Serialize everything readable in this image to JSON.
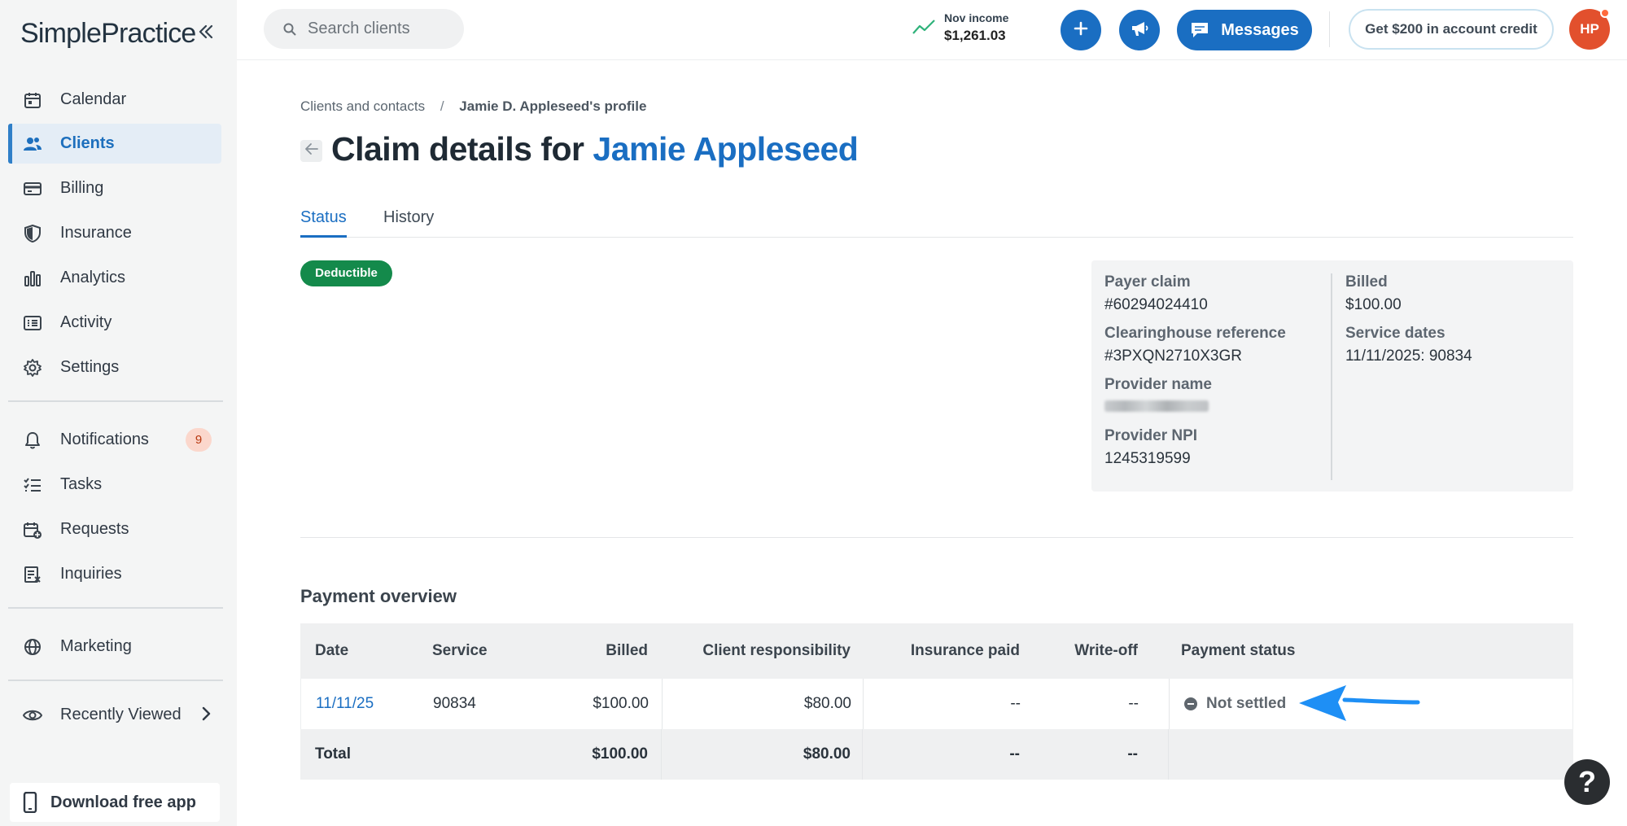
{
  "app": {
    "logo_text": "SimplePractice",
    "collapse_icon": "double-chevron-left-icon"
  },
  "sidebar": {
    "items": [
      {
        "label": "Calendar",
        "icon": "calendar-icon"
      },
      {
        "label": "Clients",
        "icon": "users-icon",
        "active": true
      },
      {
        "label": "Billing",
        "icon": "credit-card-icon"
      },
      {
        "label": "Insurance",
        "icon": "shield-icon"
      },
      {
        "label": "Analytics",
        "icon": "bar-chart-icon"
      },
      {
        "label": "Activity",
        "icon": "list-icon"
      },
      {
        "label": "Settings",
        "icon": "gear-icon"
      }
    ],
    "secondary": [
      {
        "label": "Notifications",
        "icon": "bell-icon",
        "badge": "9"
      },
      {
        "label": "Tasks",
        "icon": "checklist-icon"
      },
      {
        "label": "Requests",
        "icon": "calendar-plus-icon"
      },
      {
        "label": "Inquiries",
        "icon": "inbox-form-icon"
      }
    ],
    "marketing": {
      "label": "Marketing",
      "icon": "globe-icon"
    },
    "recently_viewed": {
      "label": "Recently Viewed",
      "icon": "eye-icon"
    },
    "download": {
      "label": "Download free app",
      "icon": "phone-icon"
    }
  },
  "topbar": {
    "search_placeholder": "Search clients",
    "income_label": "Nov income",
    "income_value": "$1,261.03",
    "messages_label": "Messages",
    "credit_label": "Get $200 in account credit",
    "avatar_initials": "HP"
  },
  "breadcrumb": {
    "parent": "Clients and contacts",
    "separator": "/",
    "current": "Jamie D. Appleseed's profile"
  },
  "page": {
    "title_prefix": "Claim details for",
    "title_name": "Jamie Appleseed",
    "tabs": [
      {
        "label": "Status",
        "active": true
      },
      {
        "label": "History",
        "active": false
      }
    ],
    "status_badge": "Deductible"
  },
  "claim_info": {
    "payer_claim_label": "Payer claim",
    "payer_claim_value": "#60294024410",
    "clearinghouse_label": "Clearinghouse reference",
    "clearinghouse_value": "#3PXQN2710X3GR",
    "provider_name_label": "Provider name",
    "provider_npi_label": "Provider NPI",
    "provider_npi_value": "1245319599",
    "billed_label": "Billed",
    "billed_value": "$100.00",
    "service_dates_label": "Service dates",
    "service_dates_value": "11/11/2025: 90834"
  },
  "payment_overview": {
    "title": "Payment overview",
    "columns": [
      "Date",
      "Service",
      "Billed",
      "Client responsibility",
      "Insurance paid",
      "Write-off",
      "Payment status"
    ],
    "rows": [
      {
        "date": "11/11/25",
        "service": "90834",
        "billed": "$100.00",
        "client_responsibility": "$80.00",
        "insurance_paid": "--",
        "write_off": "--",
        "payment_status": "Not settled"
      }
    ],
    "total": {
      "label": "Total",
      "billed": "$100.00",
      "client_responsibility": "$80.00",
      "insurance_paid": "--",
      "write_off": "--"
    }
  },
  "help_label": "?",
  "colors": {
    "accent": "#1a6ec2",
    "status_green": "#148a4b",
    "annotation_arrow": "#1e8ff5"
  }
}
